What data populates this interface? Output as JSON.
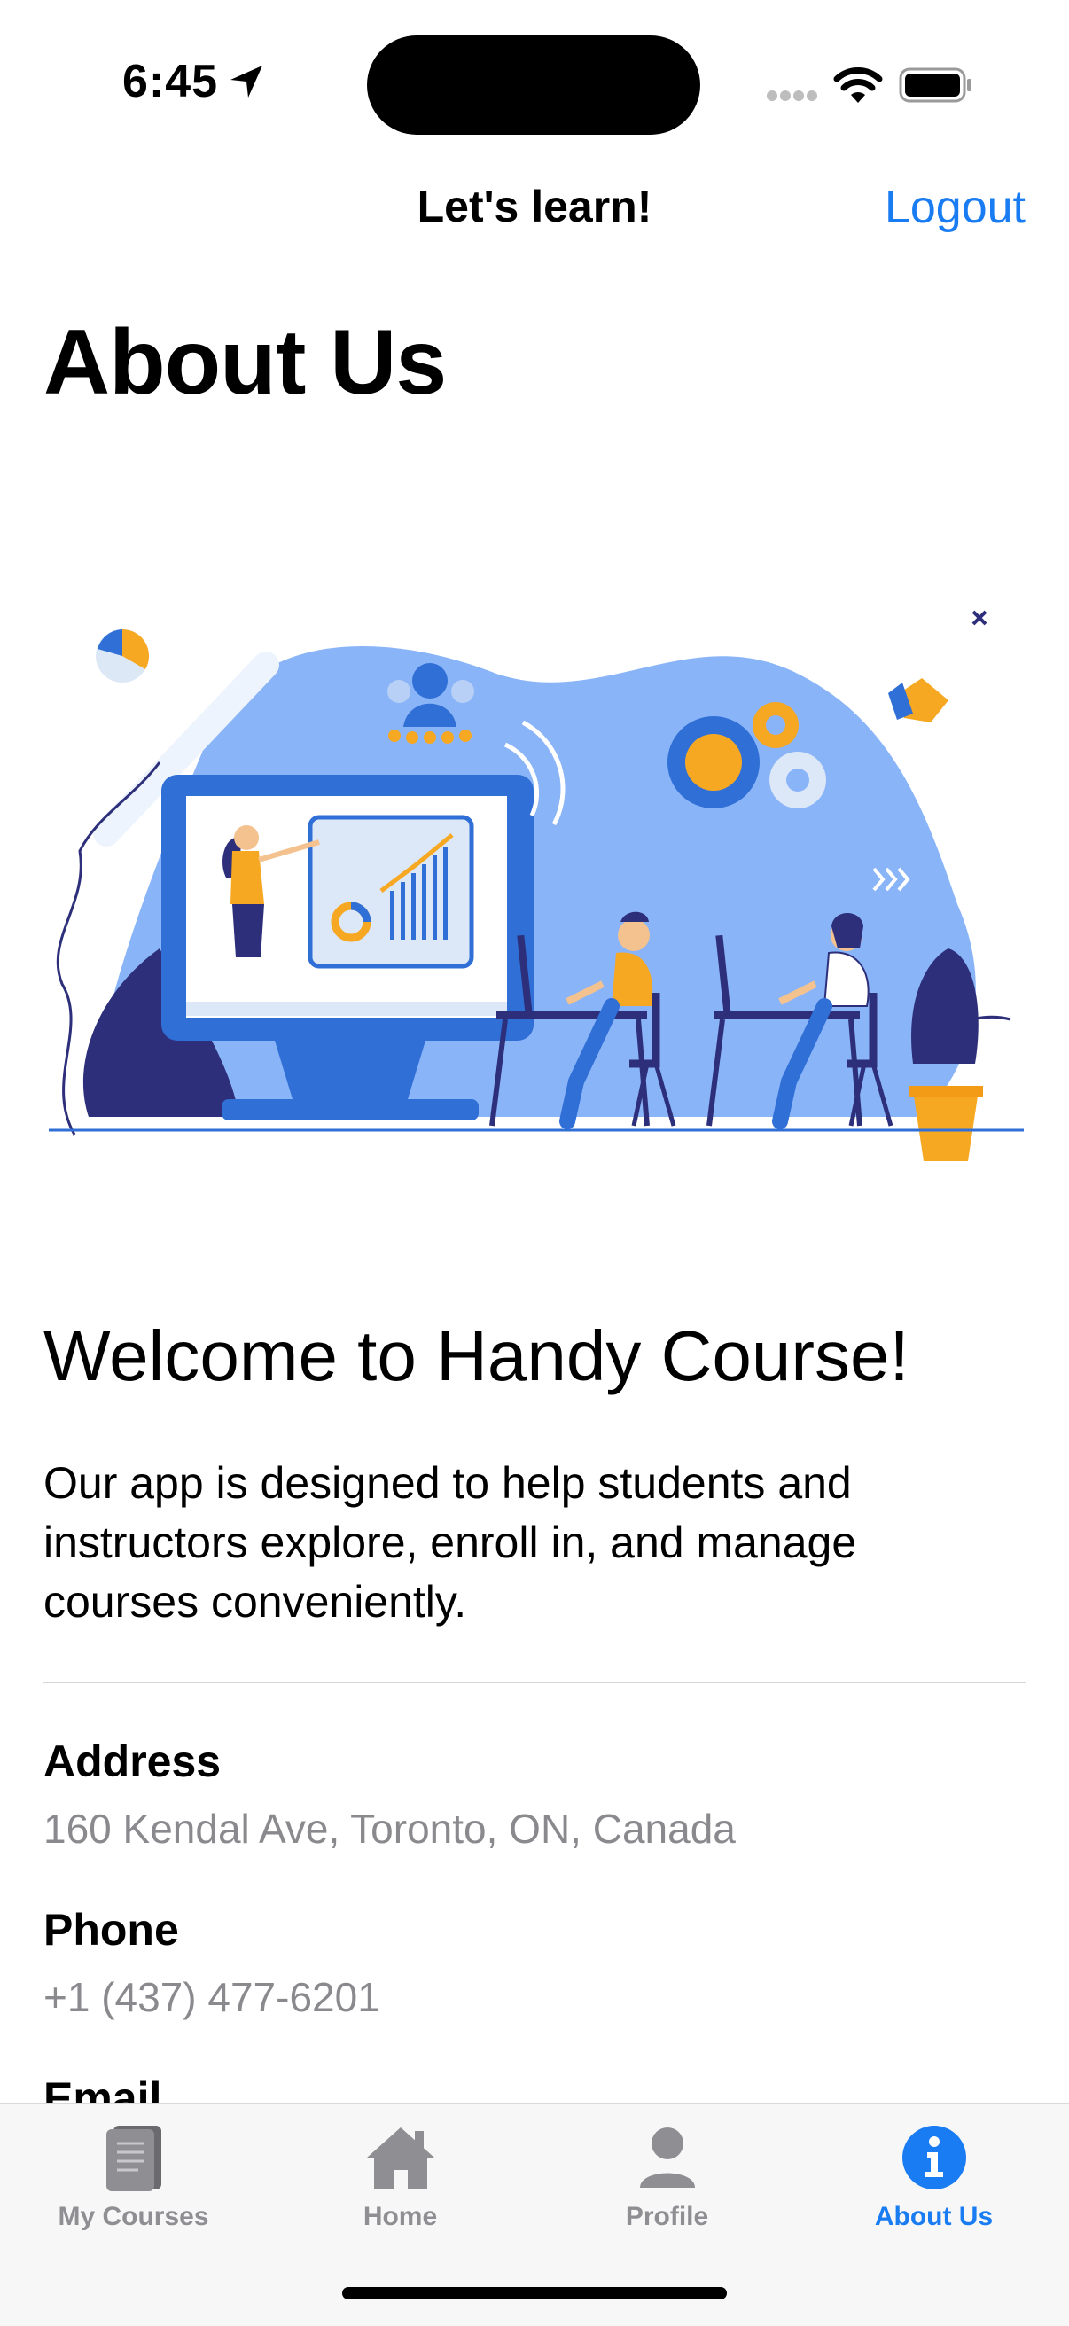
{
  "status": {
    "time": "6:45"
  },
  "nav": {
    "title": "Let's learn!",
    "logout_label": "Logout"
  },
  "page": {
    "title": "About Us"
  },
  "about": {
    "welcome": "Welcome to Handy Course!",
    "description": "Our app is designed to help students and instructors explore, enroll in, and manage courses conveniently."
  },
  "contact": [
    {
      "label": "Address",
      "value": "160 Kendal Ave, Toronto, ON, Canada"
    },
    {
      "label": "Phone",
      "value": "+1 (437) 477-6201"
    },
    {
      "label": "Email",
      "value": ""
    }
  ],
  "tabs": [
    {
      "label": "My Courses",
      "icon": "book-icon"
    },
    {
      "label": "Home",
      "icon": "house-icon"
    },
    {
      "label": "Profile",
      "icon": "person-icon"
    },
    {
      "label": "About Us",
      "icon": "info-icon"
    }
  ],
  "colors": {
    "accent": "#1a7cf2",
    "inactive": "#8e8e93",
    "illustration_blue": "#8ab4f8",
    "illustration_orange": "#f7a823"
  }
}
